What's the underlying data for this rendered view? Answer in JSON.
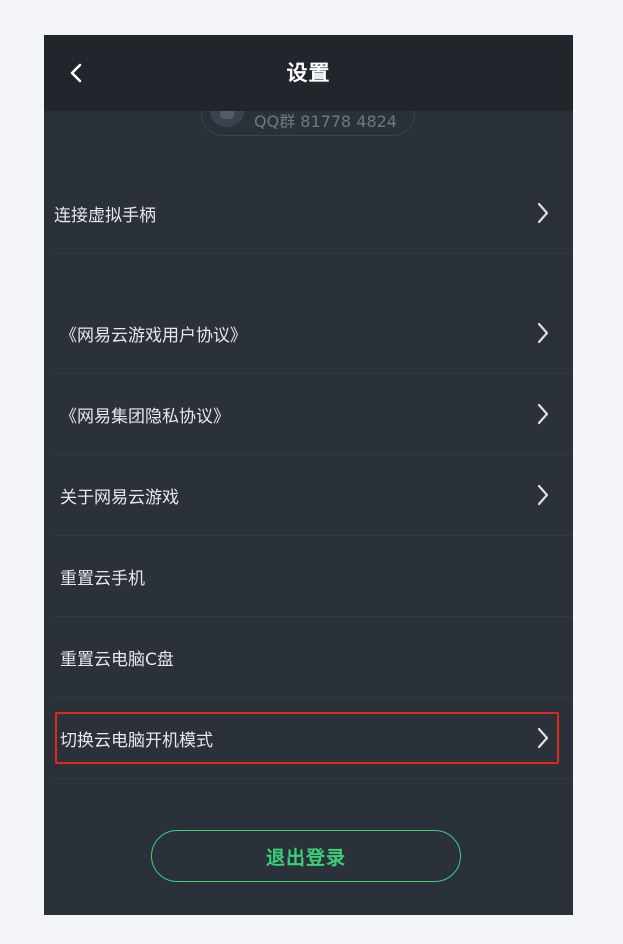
{
  "header": {
    "title": "设置",
    "back_icon": "chevron-left-icon"
  },
  "qq_group": {
    "text": "QQ群 81778 4824"
  },
  "menu": {
    "items": [
      {
        "label": "连接虚拟手柄",
        "has_arrow": true
      },
      {
        "label": "《网易云游戏用户协议》",
        "has_arrow": true
      },
      {
        "label": "《网易集团隐私协议》",
        "has_arrow": true
      },
      {
        "label": "关于网易云游戏",
        "has_arrow": true
      },
      {
        "label": "重置云手机",
        "has_arrow": false
      },
      {
        "label": "重置云电脑C盘",
        "has_arrow": false
      },
      {
        "label": "切换云电脑开机模式",
        "has_arrow": true,
        "highlighted": true
      }
    ]
  },
  "logout": {
    "label": "退出登录"
  },
  "colors": {
    "background": "#2b3139",
    "header": "#21262c",
    "accent_green": "#3ad07a",
    "highlight_red": "#e0281f"
  }
}
